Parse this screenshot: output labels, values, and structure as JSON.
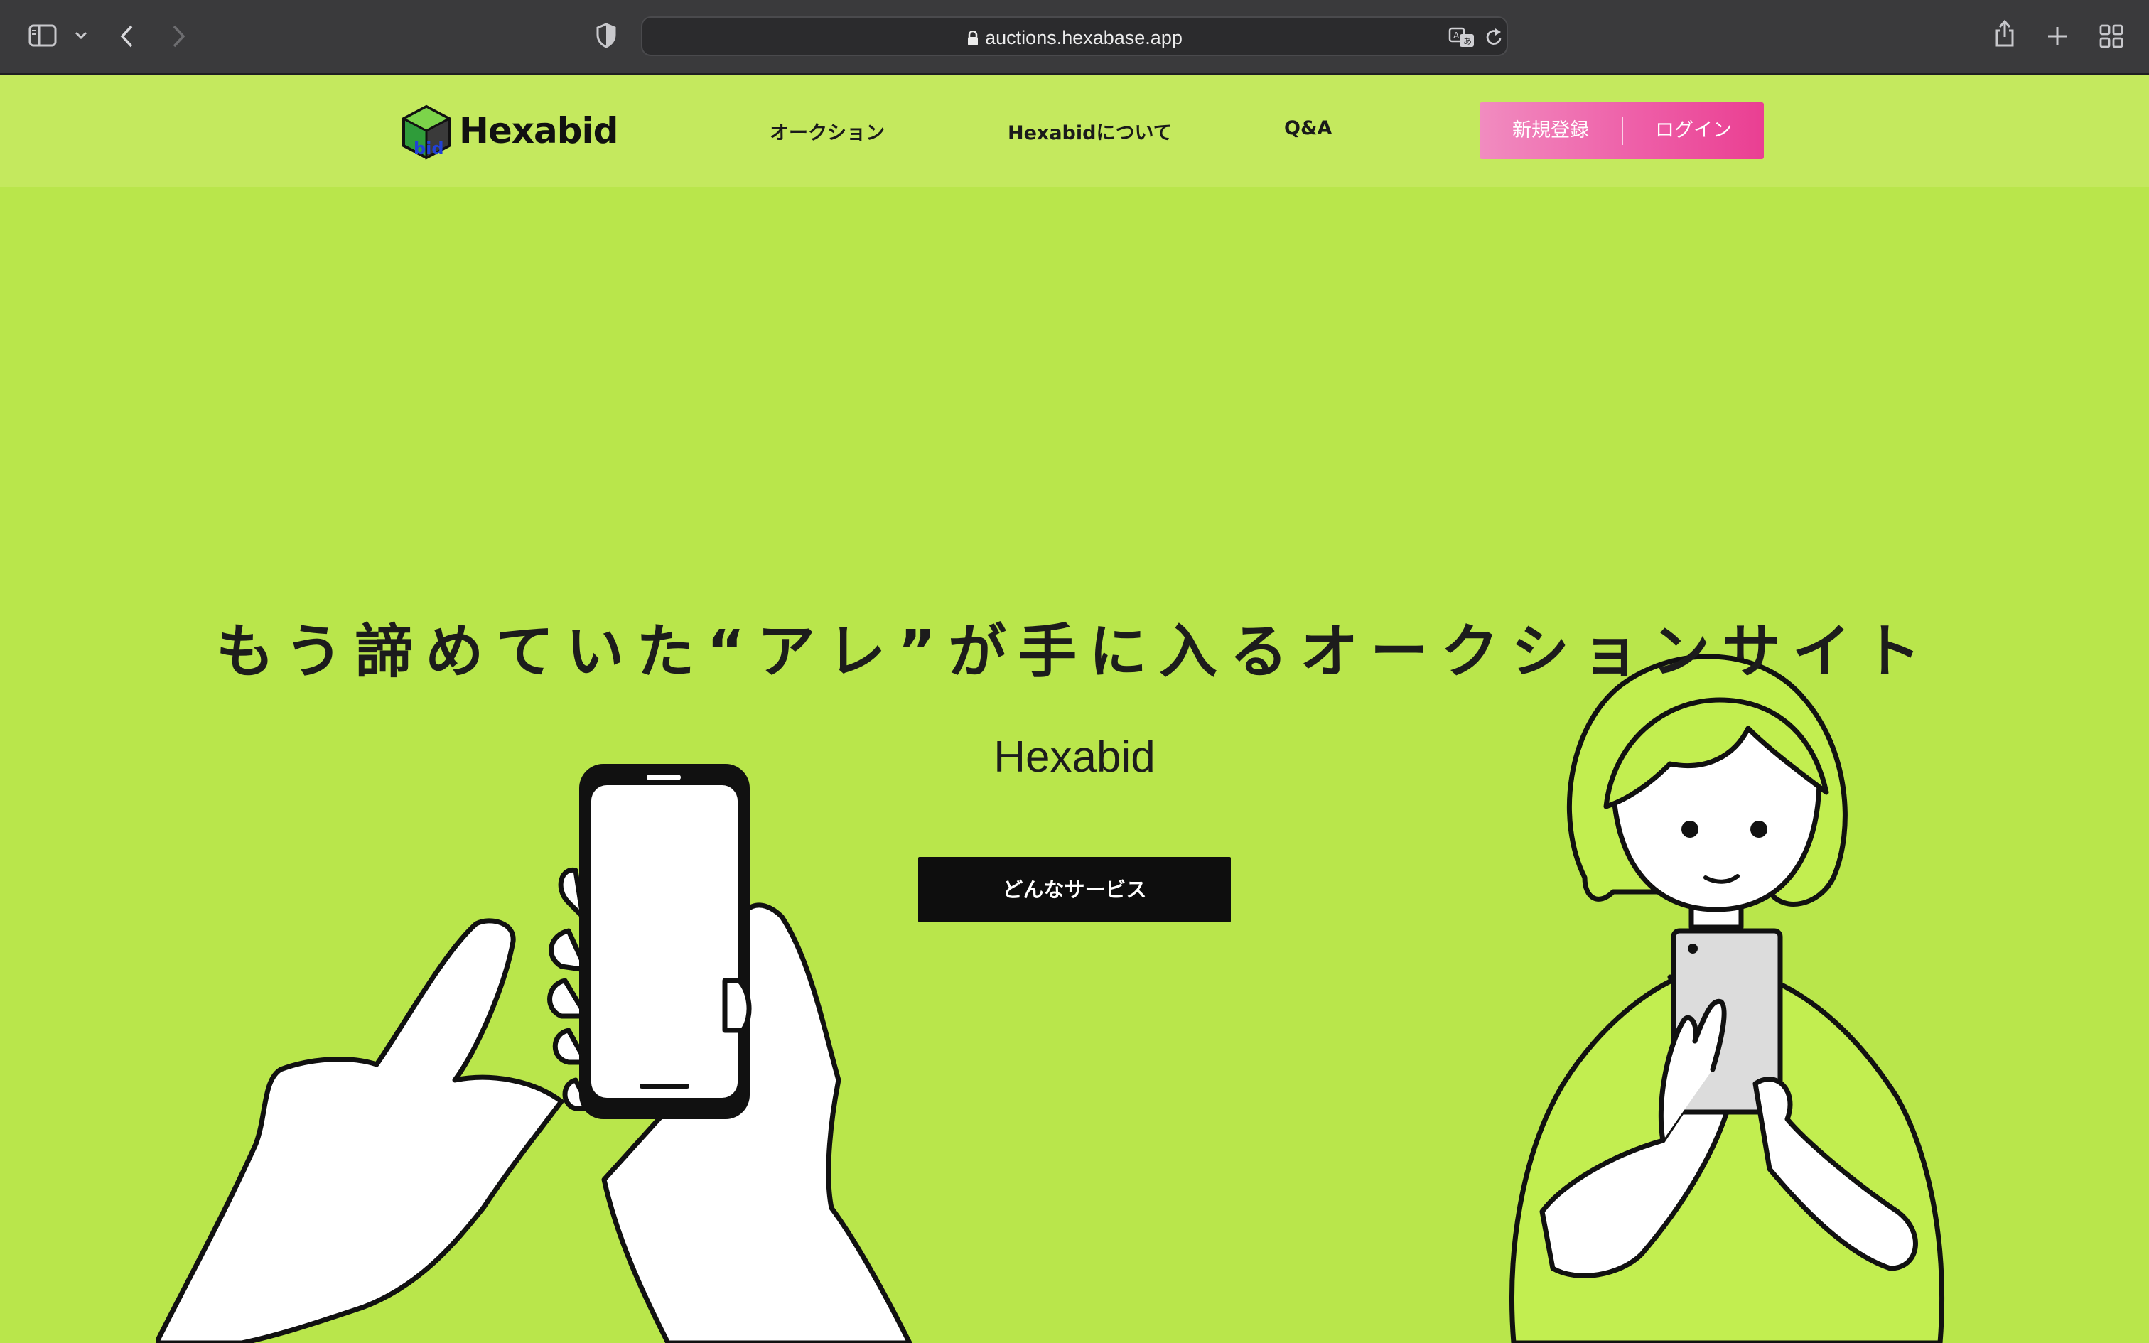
{
  "browser": {
    "url": "auctions.hexabase.app",
    "icons": [
      "sidebar-icon",
      "chevron-down-icon",
      "back-icon",
      "forward-icon",
      "shield-icon",
      "lock-icon",
      "translate-icon",
      "reload-icon",
      "share-icon",
      "new-tab-icon",
      "tab-overview-icon"
    ]
  },
  "header": {
    "logo_text": "Hexabid",
    "nav": [
      {
        "label": "オークション"
      },
      {
        "label": "Hexabidについて"
      },
      {
        "label": "Q&A"
      }
    ],
    "register_label": "新規登録",
    "login_label": "ログイン"
  },
  "hero": {
    "headline": "もう諦めていた“アレ”が手に入るオークションサイト",
    "brand": "Hexabid",
    "cta_label": "どんなサービス"
  },
  "colors": {
    "hero_bg": "#b9e64b",
    "header_bg": "#c4e95e",
    "auth_gradient_start": "#f18cc0",
    "auth_gradient_end": "#ea3f92",
    "cta_bg": "#0e0e0e"
  }
}
